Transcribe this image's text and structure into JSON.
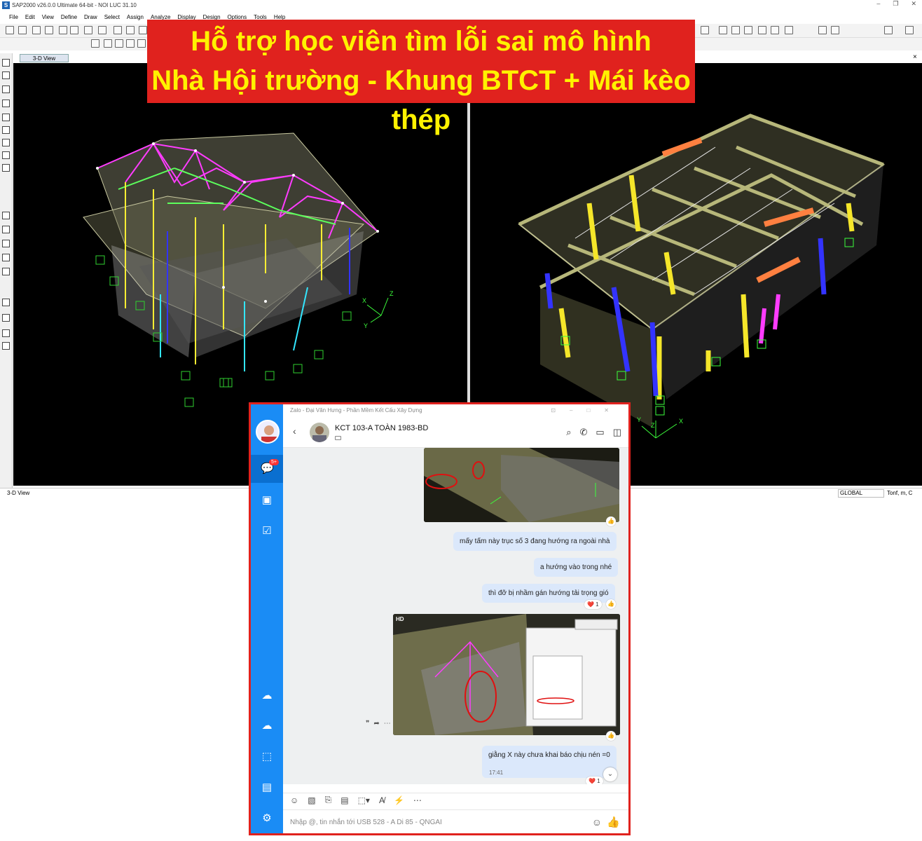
{
  "app": {
    "title": "SAP2000 v26.0.0 Ultimate 64-bit - NOI LUC 31.10",
    "icon_letter": "S",
    "menu": [
      "File",
      "Edit",
      "View",
      "Define",
      "Draw",
      "Select",
      "Assign",
      "Analyze",
      "Display",
      "Design",
      "Options",
      "Tools",
      "Help"
    ],
    "view_tab": "3-D View",
    "close_label": "×",
    "status_view": "3-D View",
    "coord_system": "GLOBAL",
    "units": "Tonf, m, C"
  },
  "banner": {
    "line1": "Hỗ trợ học viên tìm lỗi sai mô hình",
    "line2": "Nhà Hội trường - Khung BTCT + Mái kèo thép",
    "bg_color": "#e0221e",
    "text_color": "#fff200"
  },
  "axes": {
    "x": "X",
    "y": "Y",
    "z": "Z"
  },
  "zalo": {
    "window_title": "Zalo - Đại Văn Hưng - Phần Mềm Kết Cấu Xây Dựng",
    "badge": "5+",
    "chat_name": "KCT 103-A TOÀN 1983-BD",
    "messages": [
      {
        "text": "mấy tấm này trục số 3 đang hướng ra ngoài nhà"
      },
      {
        "text": "a hướng vào trong nhé"
      },
      {
        "text": "thì đỡ bị nhầm gán hướng tải trọng gió",
        "reaction": "❤️ 1"
      },
      {
        "text": "giằng X này chưa khai báo chịu nén =0",
        "time": "17:41",
        "reaction": "❤️ 1"
      }
    ],
    "hd_label": "HD",
    "input_placeholder": "Nhập @, tin nhắn tới USB 528 - A Di 85 - QNGAI",
    "accent_color": "#1a8cf5"
  }
}
